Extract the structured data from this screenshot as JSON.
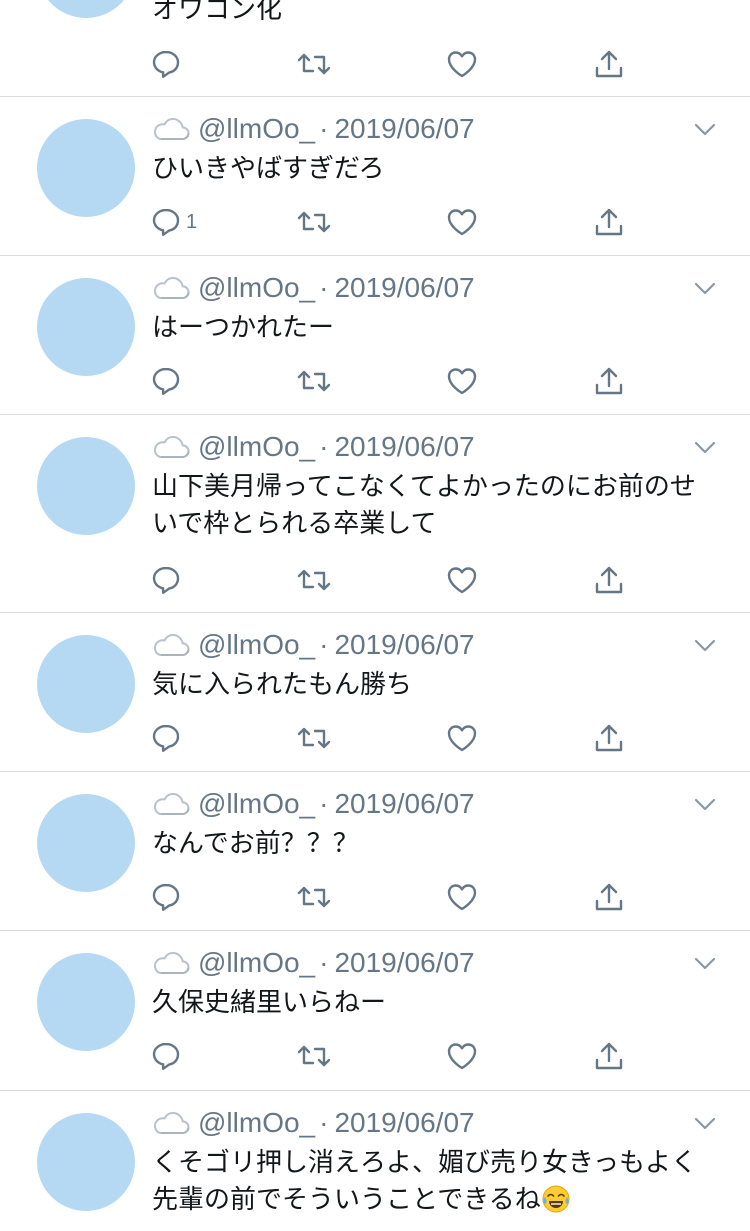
{
  "colors": {
    "avatar": "#b5d9f2",
    "meta_text": "#657786",
    "icon": "#657786",
    "divider": "#d9dde0"
  },
  "partial_tweet": {
    "text": "オワコン化"
  },
  "tweets": [
    {
      "handle": "@llmOo_",
      "separator": "·",
      "date": "2019/06/07",
      "text": "ひいきやばすぎだろ",
      "reply_count": "1"
    },
    {
      "handle": "@llmOo_",
      "separator": "·",
      "date": "2019/06/07",
      "text": "はーつかれたー",
      "reply_count": ""
    },
    {
      "handle": "@llmOo_",
      "separator": "·",
      "date": "2019/06/07",
      "text": "山下美月帰ってこなくてよかったのにお前のせいで枠とられる卒業して",
      "reply_count": ""
    },
    {
      "handle": "@llmOo_",
      "separator": "·",
      "date": "2019/06/07",
      "text": "気に入られたもん勝ち",
      "reply_count": ""
    },
    {
      "handle": "@llmOo_",
      "separator": "·",
      "date": "2019/06/07",
      "text": "なんでお前？？？",
      "reply_count": ""
    },
    {
      "handle": "@llmOo_",
      "separator": "·",
      "date": "2019/06/07",
      "text": "久保史緒里いらねー",
      "reply_count": ""
    },
    {
      "handle": "@llmOo_",
      "separator": "·",
      "date": "2019/06/07",
      "text": "くそゴリ押し消えろよ、媚び売り女きっもよく先輩の前でそういうことできるね",
      "reply_count": "",
      "emoji": "face-with-tears-of-joy-emoji"
    }
  ],
  "icons": {
    "user_badge": "cloud-icon",
    "menu": "chevron-down-icon",
    "reply": "reply-icon",
    "retweet": "retweet-icon",
    "like": "heart-icon",
    "share": "share-icon"
  }
}
